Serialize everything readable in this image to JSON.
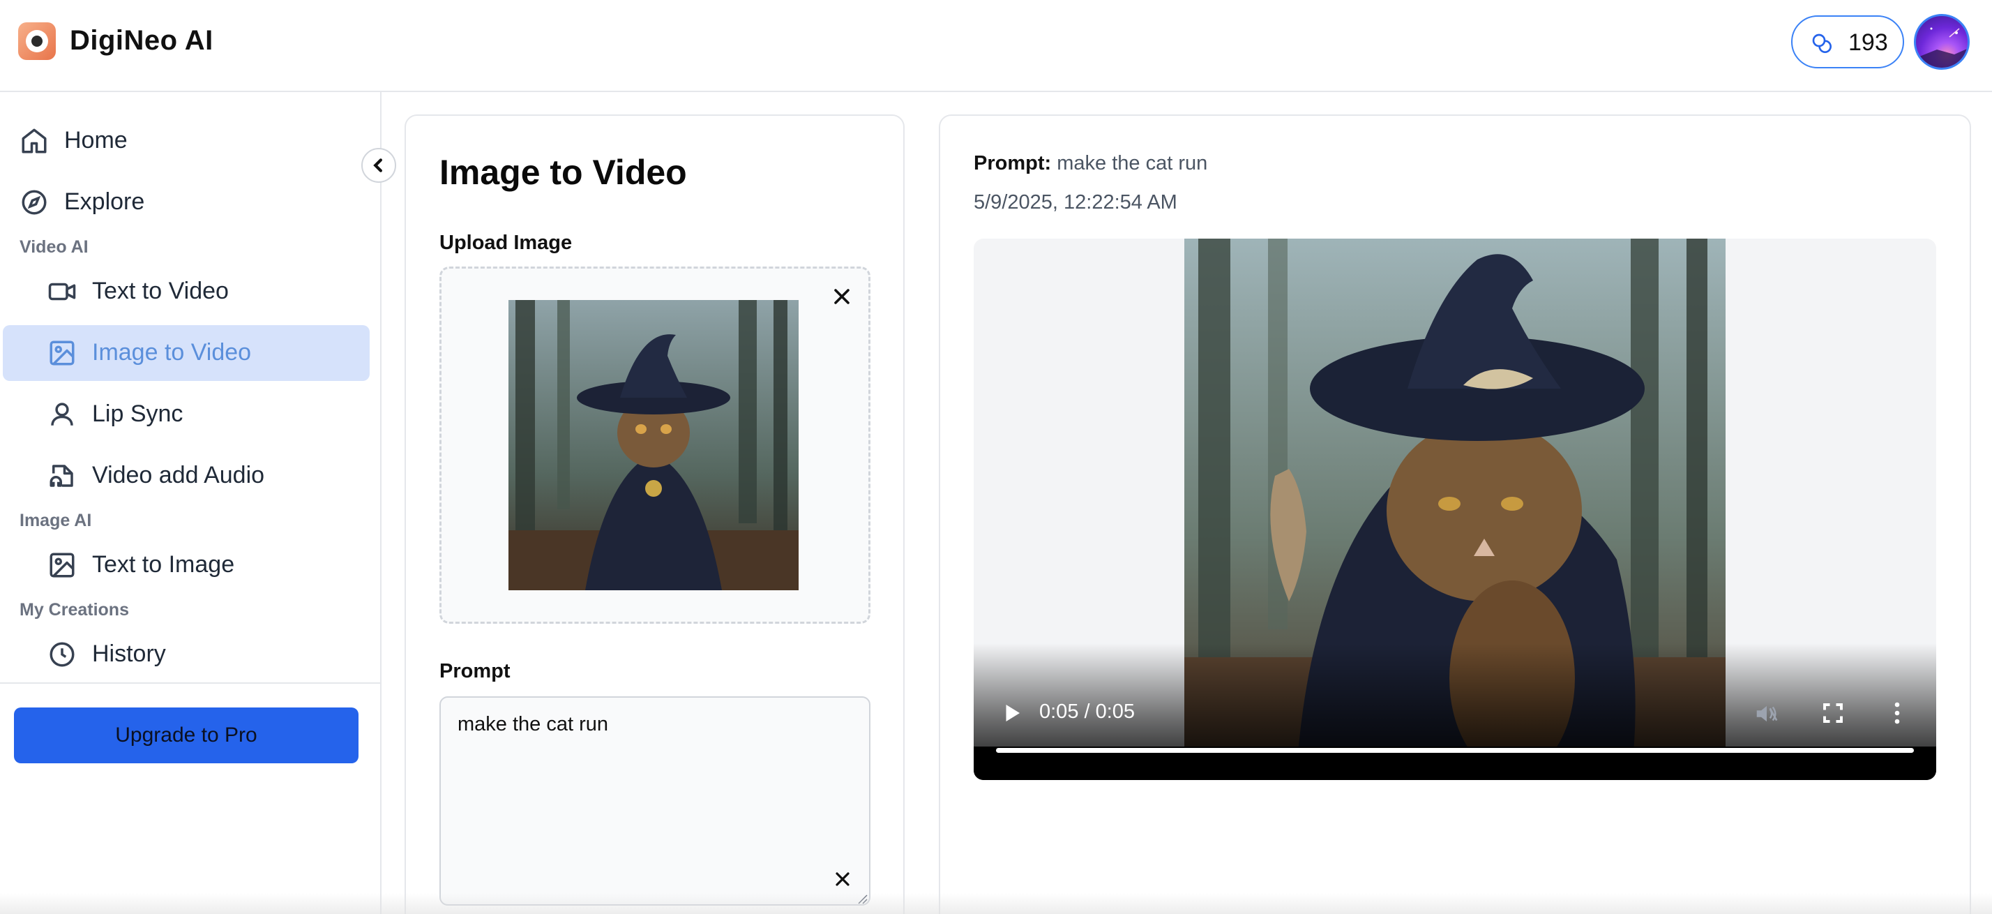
{
  "app": {
    "brand": "DigiNeo AI",
    "credits": "193",
    "accent_color": "#2563eb",
    "active_color": "#d6e2fb",
    "logo_icon": "camera-logo-icon",
    "credits_icon": "coins-icon"
  },
  "sidebar": {
    "items_top": [
      {
        "label": "Home",
        "icon": "home-icon"
      },
      {
        "label": "Explore",
        "icon": "compass-icon"
      }
    ],
    "sections": [
      {
        "label": "Video AI",
        "items": [
          {
            "label": "Text to Video",
            "icon": "video-camera-icon"
          },
          {
            "label": "Image to Video",
            "icon": "image-icon",
            "active": true
          },
          {
            "label": "Lip Sync",
            "icon": "user-icon"
          },
          {
            "label": "Video add Audio",
            "icon": "audio-file-icon"
          }
        ]
      },
      {
        "label": "Image AI",
        "items": [
          {
            "label": "Text to Image",
            "icon": "image-icon"
          }
        ]
      },
      {
        "label": "My Creations",
        "items": [
          {
            "label": "History",
            "icon": "clock-icon"
          }
        ]
      }
    ],
    "upgrade_label": "Upgrade to Pro"
  },
  "form": {
    "title": "Image to Video",
    "upload_label": "Upload Image",
    "prompt_label": "Prompt",
    "prompt_value": "make the cat run"
  },
  "result": {
    "prompt_key": "Prompt:",
    "prompt_value": "make the cat run",
    "timestamp": "5/9/2025, 12:22:54 AM",
    "video_time": "0:05 / 0:05",
    "video_progress": 1.0
  }
}
